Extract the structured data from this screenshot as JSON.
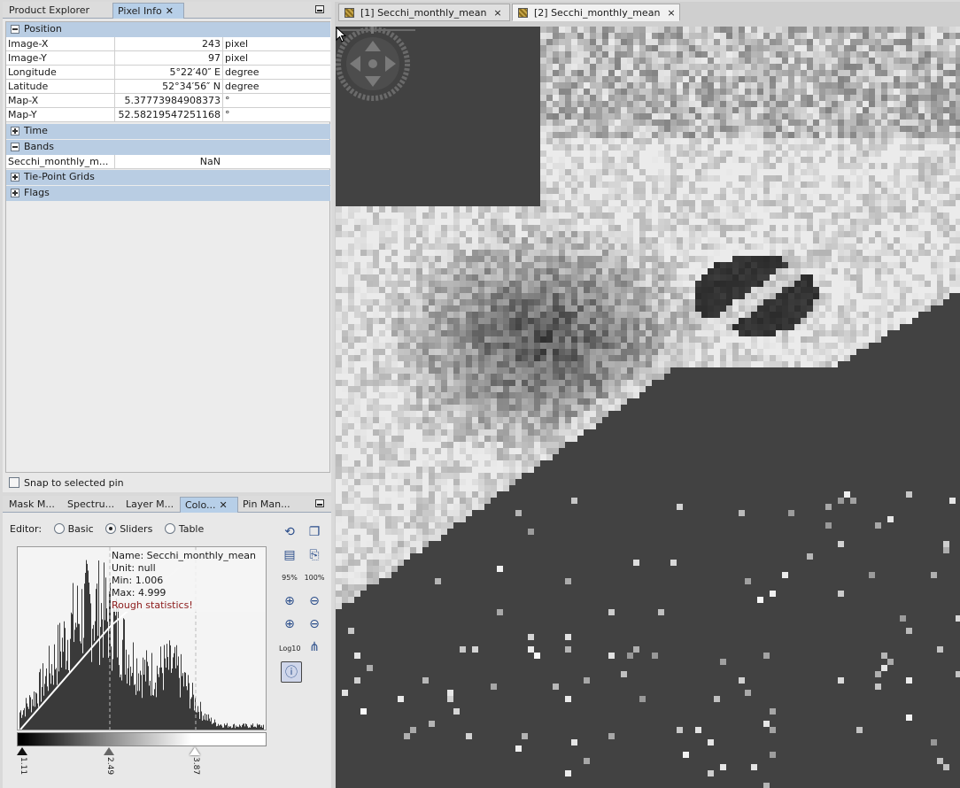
{
  "top_panel": {
    "tabs": [
      {
        "label": "Product Explorer"
      },
      {
        "label": "Pixel Info",
        "close": "✕"
      }
    ]
  },
  "pixel_info": {
    "groups": {
      "position": "Position",
      "time": "Time",
      "bands": "Bands",
      "tie_point_grids": "Tie-Point Grids",
      "flags": "Flags"
    },
    "position_rows": [
      {
        "name": "Image-X",
        "value": "243",
        "unit": "pixel"
      },
      {
        "name": "Image-Y",
        "value": "97",
        "unit": "pixel"
      },
      {
        "name": "Longitude",
        "value": "5°22′40″ E",
        "unit": "degree"
      },
      {
        "name": "Latitude",
        "value": "52°34′56″ N",
        "unit": "degree"
      },
      {
        "name": "Map-X",
        "value": "5.37773984908373",
        "unit": "°"
      },
      {
        "name": "Map-Y",
        "value": "52.58219547251168",
        "unit": "°"
      }
    ],
    "band_rows": [
      {
        "name": "Secchi_monthly_m...",
        "value": "NaN",
        "unit": ""
      }
    ],
    "snap_label": "Snap to selected pin"
  },
  "bottom_panel": {
    "tabs": [
      {
        "label": "Mask M..."
      },
      {
        "label": "Spectru..."
      },
      {
        "label": "Layer M..."
      },
      {
        "label": "Colo...",
        "close": "✕"
      },
      {
        "label": "Pin Man..."
      }
    ],
    "editor": {
      "label": "Editor:",
      "options": [
        "Basic",
        "Sliders",
        "Table"
      ],
      "selected": "Sliders"
    },
    "histogram_info": {
      "name": "Name: Secchi_monthly_mean",
      "unit": "Unit: null",
      "min": "Min: 1.006",
      "max": "Max: 4.999",
      "warning": "Rough statistics!"
    },
    "sliders": [
      {
        "label": "1.11",
        "value": 1.11
      },
      {
        "label": "2.49",
        "value": 2.49
      },
      {
        "label": "3.87",
        "value": 3.87
      }
    ],
    "tools": {
      "zoom_95": "95%",
      "zoom_100": "100%",
      "log_label": "Log10"
    }
  },
  "image_view": {
    "tabs": [
      {
        "label": "[1] Secchi_monthly_mean",
        "close": "×"
      },
      {
        "label": "[2] Secchi_monthly_mean",
        "close": "×",
        "active": true
      }
    ]
  },
  "colors": {
    "selected_tab": "#b7cfe8",
    "group_header": "#b9cde3",
    "warning_text": "#8b1a1a",
    "map_background": "#424242"
  }
}
